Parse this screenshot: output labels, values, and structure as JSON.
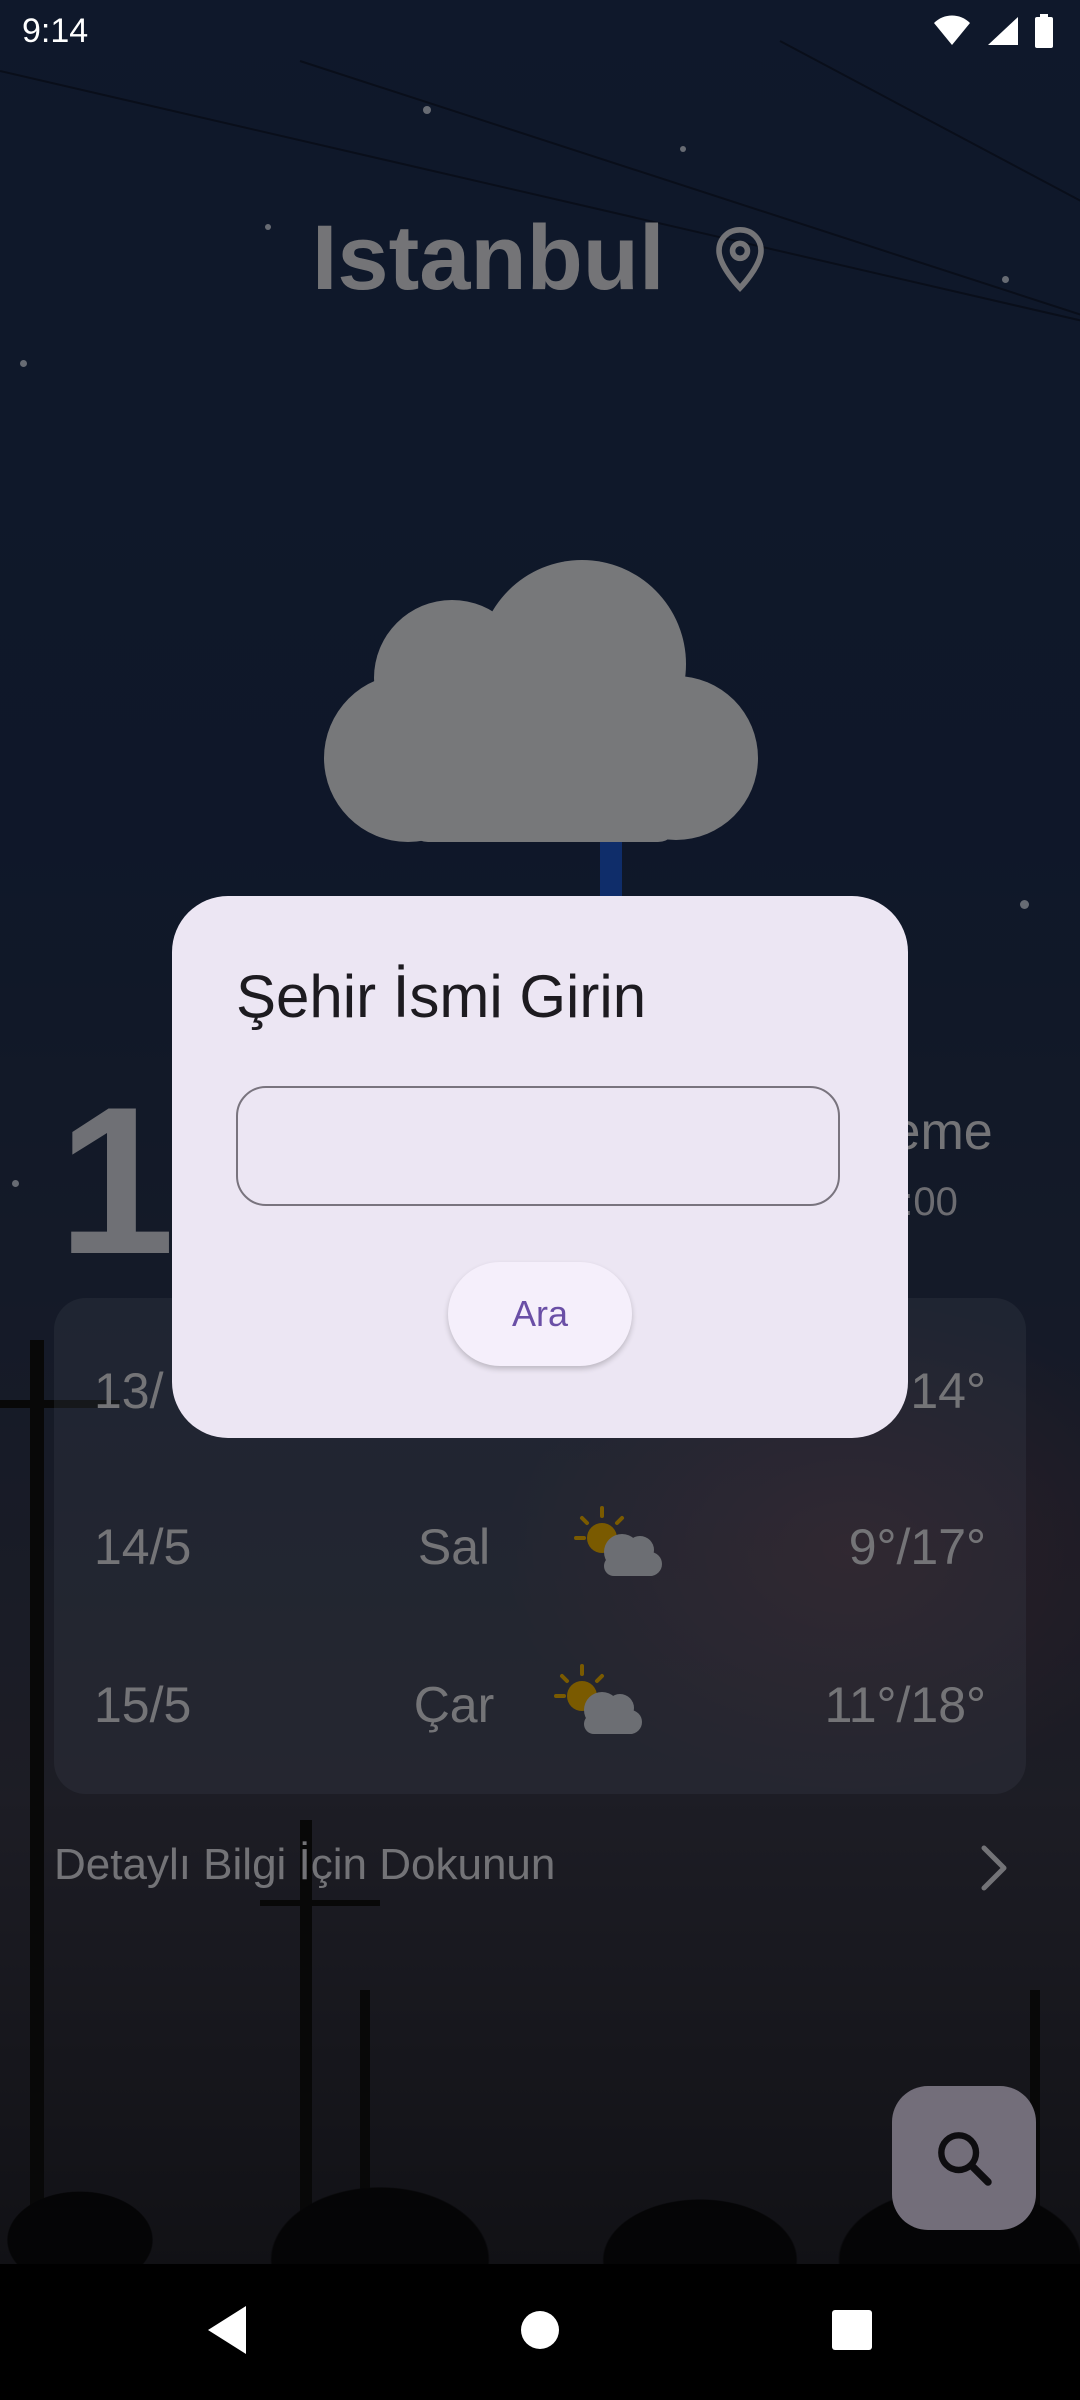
{
  "status_bar": {
    "time": "9:14",
    "icons": [
      "wifi-icon",
      "signal-icon",
      "battery-icon"
    ]
  },
  "city": {
    "name": "Istanbul",
    "icon": "location-pin-icon"
  },
  "current": {
    "temp_partial": "1",
    "update_label_partial": "leme",
    "update_time_partial": "2:00",
    "icon": "cloud-icon"
  },
  "forecast": [
    {
      "date": "13/",
      "day": "",
      "icon": "",
      "temps": "14°"
    },
    {
      "date": "14/5",
      "day": "Sal",
      "icon": "partly-cloudy-icon",
      "temps": "9°/17°"
    },
    {
      "date": "15/5",
      "day": "Çar",
      "icon": "partly-cloudy-icon",
      "temps": "11°/18°"
    }
  ],
  "details": {
    "label": "Detaylı Bilgi İçin Dokunun",
    "icon": "chevron-right-icon"
  },
  "fab": {
    "icon": "search-icon"
  },
  "dialog": {
    "title": "Şehir İsmi Girin",
    "input_value": "",
    "input_placeholder": "",
    "button_label": "Ara"
  },
  "nav_bar": {
    "buttons": [
      "back-icon",
      "home-icon",
      "recents-icon"
    ]
  },
  "colors": {
    "dialog_bg": "#ece6f3",
    "accent": "#6a4fa6",
    "fab_bg": "#e7dcf4"
  }
}
